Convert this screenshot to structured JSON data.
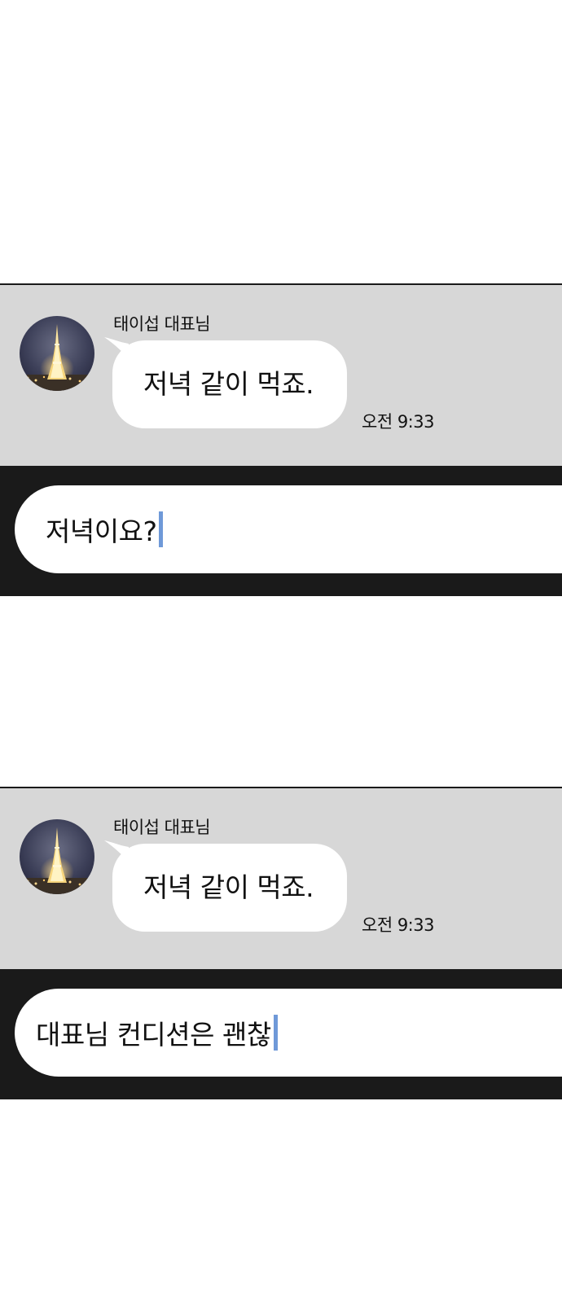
{
  "panels": [
    {
      "sender_name": "태이섭 대표님",
      "avatar_icon": "eiffel-tower-night-photo",
      "message": "저녁 같이 먹죠.",
      "time": "오전 9:33",
      "input_value": "저녁이요?"
    },
    {
      "sender_name": "태이섭 대표님",
      "avatar_icon": "eiffel-tower-night-photo",
      "message": "저녁 같이 먹죠.",
      "time": "오전 9:33",
      "input_value": "대표님 컨디션은 괜찮"
    }
  ],
  "colors": {
    "chat_background": "#d7d7d7",
    "bubble": "#ffffff",
    "input_bar": "#1a1a1a",
    "caret": "#6f99d8",
    "page": "#ffffff"
  }
}
